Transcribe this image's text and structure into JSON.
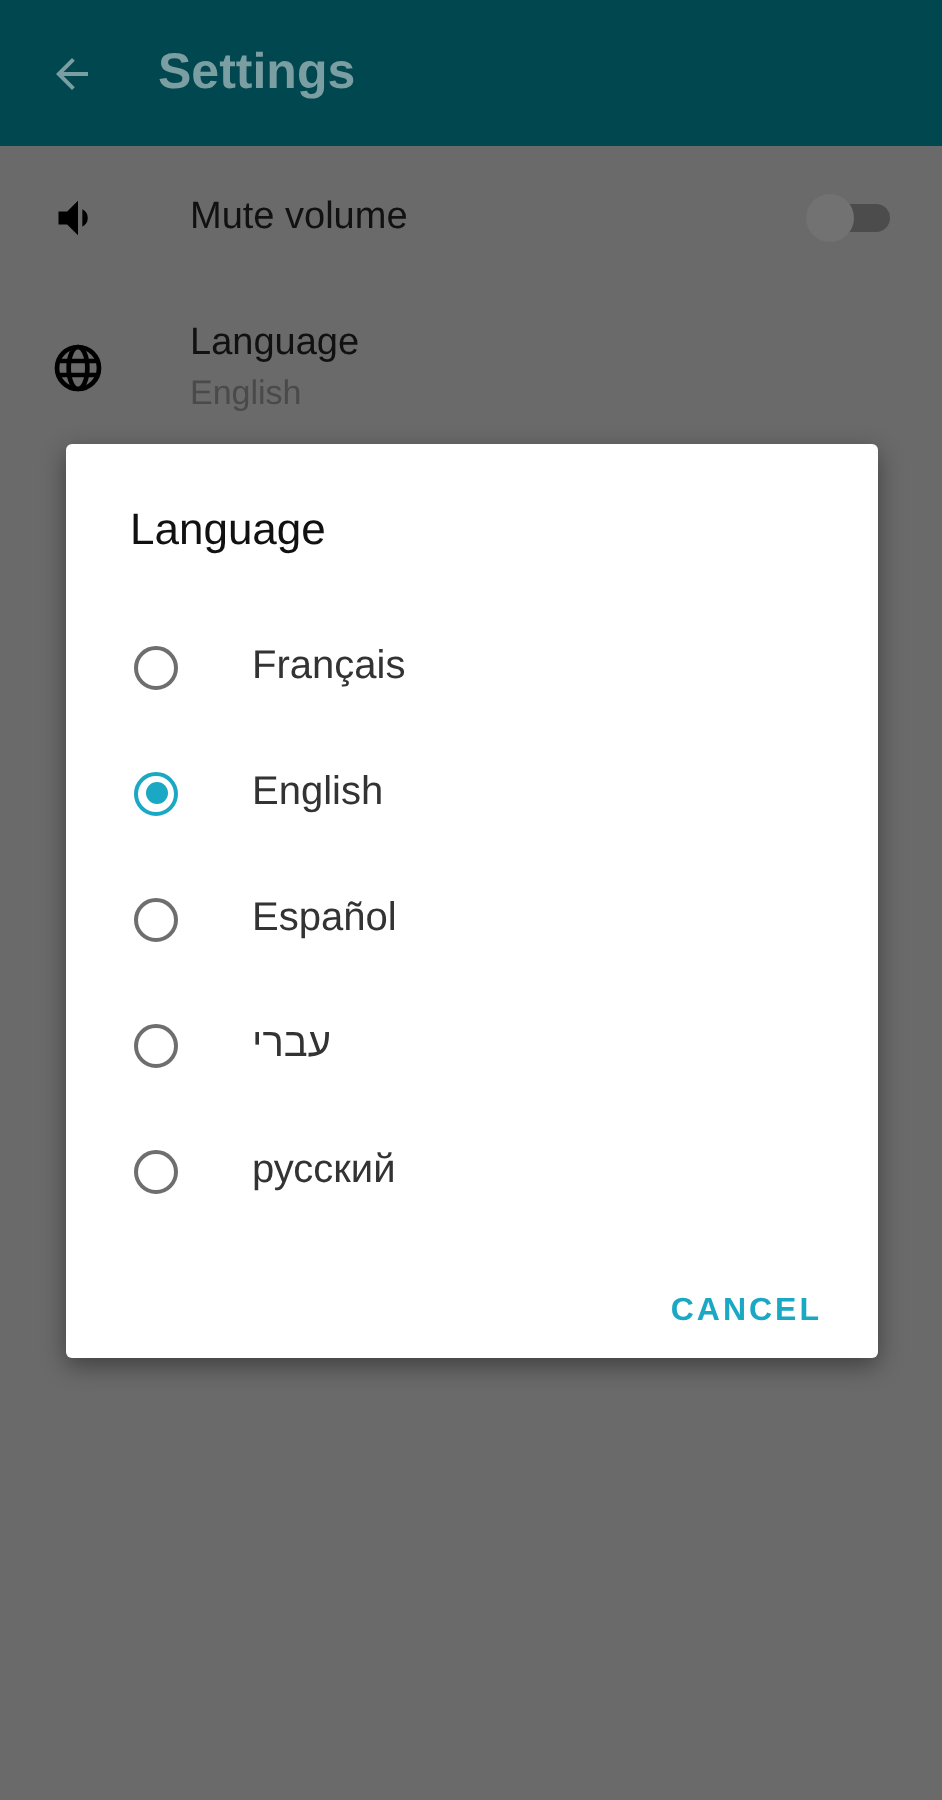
{
  "app_bar": {
    "title": "Settings"
  },
  "settings": [
    {
      "kind": "toggle",
      "label": "Mute volume",
      "on": false
    },
    {
      "kind": "choice",
      "label": "Language",
      "value": "English"
    }
  ],
  "dialog": {
    "title": "Language",
    "options": [
      {
        "label": "Français",
        "selected": false
      },
      {
        "label": "English",
        "selected": true
      },
      {
        "label": "Español",
        "selected": false
      },
      {
        "label": "עברי",
        "selected": false
      },
      {
        "label": "русский",
        "selected": false
      }
    ],
    "buttons": [
      "CANCEL"
    ]
  }
}
